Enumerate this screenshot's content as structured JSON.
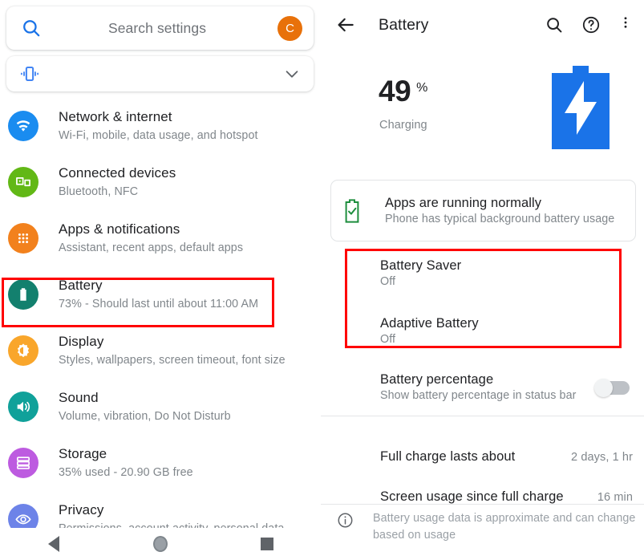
{
  "left_panel": {
    "search": {
      "placeholder": "Search settings",
      "icon": "search-icon",
      "avatar_letter": "C",
      "avatar_color": "#E8710A"
    },
    "expander": {
      "icon": "vibration-icon",
      "chevron": "chevron-down-icon"
    },
    "items": [
      {
        "title": "Network & internet",
        "subtitle": "Wi-Fi, mobile, data usage, and hotspot",
        "icon": "wifi-icon",
        "color": "#1A8CF0"
      },
      {
        "title": "Connected devices",
        "subtitle": "Bluetooth, NFC",
        "icon": "connected-devices-icon",
        "color": "#62B816"
      },
      {
        "title": "Apps & notifications",
        "subtitle": "Assistant, recent apps, default apps",
        "icon": "apps-grid-icon",
        "color": "#F2811D"
      },
      {
        "title": "Battery",
        "subtitle": "73% - Should last until about 11:00 AM",
        "icon": "battery-icon",
        "color": "#13806E"
      },
      {
        "title": "Display",
        "subtitle": "Styles, wallpapers, screen timeout, font size",
        "icon": "brightness-icon",
        "color": "#F9A62B"
      },
      {
        "title": "Sound",
        "subtitle": "Volume, vibration, Do Not Disturb",
        "icon": "speaker-icon",
        "color": "#10A19A"
      },
      {
        "title": "Storage",
        "subtitle": "35% used - 20.90 GB free",
        "icon": "storage-icon",
        "color": "#BD5BE0"
      },
      {
        "title": "Privacy",
        "subtitle": "Permissions, account activity, personal data",
        "icon": "privacy-eye-icon",
        "color": "#6D83E8"
      }
    ]
  },
  "right_panel": {
    "appbar": {
      "back_icon": "back-arrow-icon",
      "title": "Battery",
      "search_icon": "search-icon",
      "help_icon": "help-circle-icon",
      "overflow_icon": "overflow-menu-icon"
    },
    "hero": {
      "percent": "49",
      "percent_symbol": "%",
      "state": "Charging",
      "graphic": "charging-battery-icon",
      "graphic_color": "#1A73E8"
    },
    "status_card": {
      "icon": "battery-check-icon",
      "icon_color": "#1E8E3E",
      "title": "Apps are running normally",
      "subtitle": "Phone has typical background battery usage"
    },
    "settings": [
      {
        "title": "Battery Saver",
        "value": "Off"
      },
      {
        "title": "Adaptive Battery",
        "value": "Off"
      },
      {
        "title": "Battery percentage",
        "subtitle": "Show battery percentage in status bar",
        "toggle_state": "off"
      }
    ],
    "info_rows": [
      {
        "label": "Full charge lasts about",
        "value": "2 days, 1 hr"
      },
      {
        "label": "Screen usage since full charge",
        "value": "16 min"
      }
    ],
    "footnote": {
      "icon": "info-circle-icon",
      "text": "Battery usage data is approximate and can change based on usage"
    }
  },
  "annotations": {
    "color": "#FF0000",
    "boxes": [
      {
        "name": "battery-settings-item"
      },
      {
        "name": "battery-modes-group"
      }
    ]
  },
  "navbar": {
    "back": "nav-back-icon",
    "home": "nav-home-icon",
    "recents": "nav-recents-icon"
  }
}
